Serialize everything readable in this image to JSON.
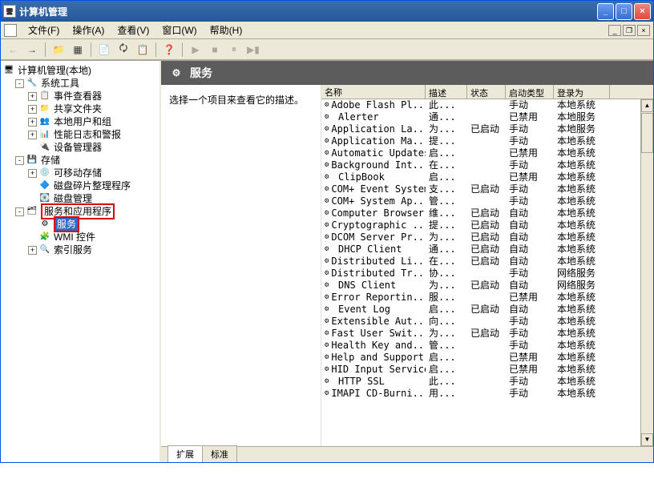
{
  "window": {
    "title": "计算机管理"
  },
  "menu": {
    "file": "文件(F)",
    "action": "操作(A)",
    "view": "查看(V)",
    "window": "窗口(W)",
    "help": "帮助(H)"
  },
  "tree": {
    "root": "计算机管理(本地)",
    "systools": "系统工具",
    "eventvwr": "事件查看器",
    "shared": "共享文件夹",
    "users": "本地用户和组",
    "perf": "性能日志和警报",
    "devmgr": "设备管理器",
    "storage": "存储",
    "removable": "可移动存储",
    "defrag": "磁盘碎片整理程序",
    "diskmgmt": "磁盘管理",
    "svcapps": "服务和应用程序",
    "services": "服务",
    "wmi": "WMI 控件",
    "indexing": "索引服务"
  },
  "banner": {
    "title": "服务"
  },
  "description": "选择一个项目来查看它的描述。",
  "columns": {
    "name": "名称",
    "desc": "描述",
    "status": "状态",
    "startup": "启动类型",
    "logon": "登录为"
  },
  "services": [
    {
      "name": "Adobe Flash Pl...",
      "desc": "此...",
      "status": "",
      "startup": "手动",
      "logon": "本地系统"
    },
    {
      "name": "Alerter",
      "desc": "通...",
      "status": "",
      "startup": "已禁用",
      "logon": "本地服务"
    },
    {
      "name": "Application La...",
      "desc": "为...",
      "status": "已启动",
      "startup": "手动",
      "logon": "本地服务"
    },
    {
      "name": "Application Ma...",
      "desc": "提...",
      "status": "",
      "startup": "手动",
      "logon": "本地系统"
    },
    {
      "name": "Automatic Updates",
      "desc": "启...",
      "status": "",
      "startup": "已禁用",
      "logon": "本地系统"
    },
    {
      "name": "Background Int...",
      "desc": "在...",
      "status": "",
      "startup": "手动",
      "logon": "本地系统"
    },
    {
      "name": "ClipBook",
      "desc": "启...",
      "status": "",
      "startup": "已禁用",
      "logon": "本地系统"
    },
    {
      "name": "COM+ Event System",
      "desc": "支...",
      "status": "已启动",
      "startup": "手动",
      "logon": "本地系统"
    },
    {
      "name": "COM+ System Ap...",
      "desc": "管...",
      "status": "",
      "startup": "手动",
      "logon": "本地系统"
    },
    {
      "name": "Computer Browser",
      "desc": "维...",
      "status": "已启动",
      "startup": "自动",
      "logon": "本地系统"
    },
    {
      "name": "Cryptographic ...",
      "desc": "提...",
      "status": "已启动",
      "startup": "自动",
      "logon": "本地系统"
    },
    {
      "name": "DCOM Server Pr...",
      "desc": "为...",
      "status": "已启动",
      "startup": "自动",
      "logon": "本地系统"
    },
    {
      "name": "DHCP Client",
      "desc": "通...",
      "status": "已启动",
      "startup": "自动",
      "logon": "本地系统"
    },
    {
      "name": "Distributed Li...",
      "desc": "在...",
      "status": "已启动",
      "startup": "自动",
      "logon": "本地系统"
    },
    {
      "name": "Distributed Tr...",
      "desc": "协...",
      "status": "",
      "startup": "手动",
      "logon": "网络服务"
    },
    {
      "name": "DNS Client",
      "desc": "为...",
      "status": "已启动",
      "startup": "自动",
      "logon": "网络服务"
    },
    {
      "name": "Error Reportin...",
      "desc": "服...",
      "status": "",
      "startup": "已禁用",
      "logon": "本地系统"
    },
    {
      "name": "Event Log",
      "desc": "启...",
      "status": "已启动",
      "startup": "自动",
      "logon": "本地系统"
    },
    {
      "name": "Extensible Aut...",
      "desc": "向...",
      "status": "",
      "startup": "手动",
      "logon": "本地系统"
    },
    {
      "name": "Fast User Swit...",
      "desc": "为...",
      "status": "已启动",
      "startup": "手动",
      "logon": "本地系统"
    },
    {
      "name": "Health Key and...",
      "desc": "管...",
      "status": "",
      "startup": "手动",
      "logon": "本地系统"
    },
    {
      "name": "Help and Support",
      "desc": "启...",
      "status": "",
      "startup": "已禁用",
      "logon": "本地系统"
    },
    {
      "name": "HID Input Service",
      "desc": "启...",
      "status": "",
      "startup": "已禁用",
      "logon": "本地系统"
    },
    {
      "name": "HTTP SSL",
      "desc": "此...",
      "status": "",
      "startup": "手动",
      "logon": "本地系统"
    },
    {
      "name": "IMAPI CD-Burni...",
      "desc": "用...",
      "status": "",
      "startup": "手动",
      "logon": "本地系统"
    }
  ],
  "tabs": {
    "extended": "扩展",
    "standard": "标准"
  }
}
